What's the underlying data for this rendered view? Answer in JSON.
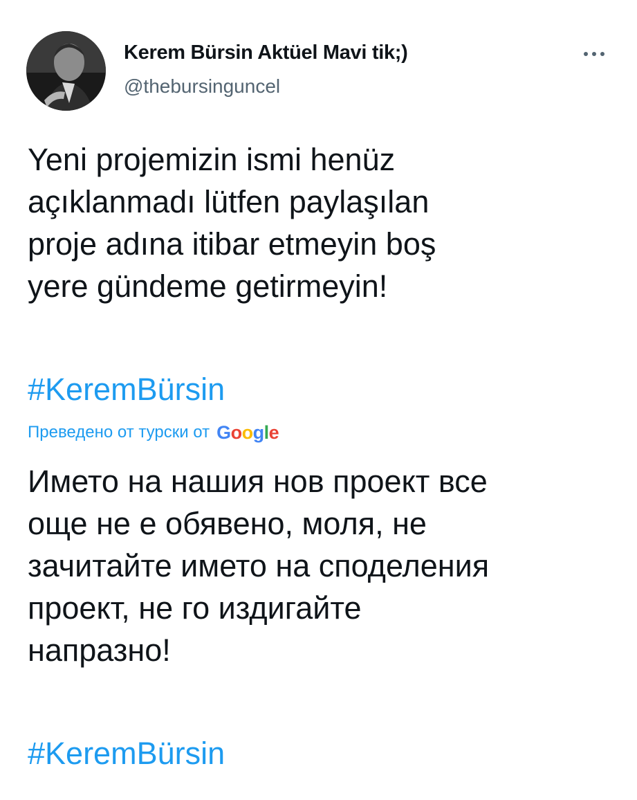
{
  "author": {
    "name": "Kerem Bürsin Aktüel Mavi tik;)",
    "handle": "@thebursinguncel",
    "avatar_icon": "profile-photo"
  },
  "more_icon": "more-horizontal-icon",
  "tweet": {
    "text": "Yeni projemizin ismi henüz\naçıklanmadı lütfen paylaşılan\nproje adına itibar etmeyin boş\nyere gündeme getirmeyin!",
    "hashtag": "#KeremBürsin"
  },
  "translation": {
    "label": "Преведено от турски от",
    "provider_letters": [
      "G",
      "o",
      "o",
      "g",
      "l",
      "e"
    ],
    "text": "Името на нашия нов проект все\nоще не е обявено, моля, не\nзачитайте името на споделения\nпроект, не го издигайте\nнапразно!",
    "hashtag": "#KeremBürsin"
  },
  "colors": {
    "link": "#1d9bf0",
    "text": "#0f1419",
    "secondary": "#536471",
    "google_blue": "#4285f4",
    "google_red": "#ea4335",
    "google_yellow": "#fbbc05",
    "google_green": "#34a853"
  }
}
